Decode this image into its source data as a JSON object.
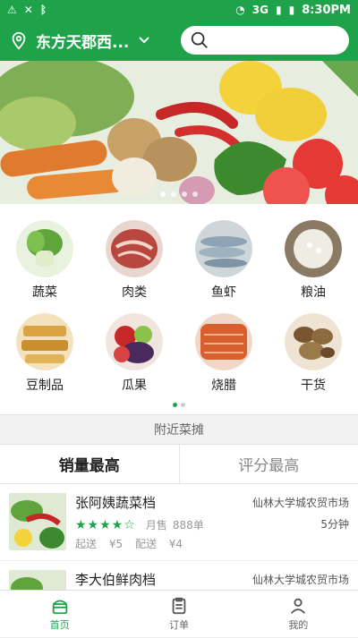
{
  "status_bar": {
    "time": "8:30PM",
    "network": "3G"
  },
  "header": {
    "location": "东方天郡西...",
    "search_placeholder": ""
  },
  "banner": {
    "slides": 4,
    "active": 0
  },
  "categories": [
    {
      "label": "蔬菜",
      "icon": "vegetables",
      "color": "#6aa84f"
    },
    {
      "label": "肉类",
      "icon": "meat",
      "color": "#c0504d"
    },
    {
      "label": "鱼虾",
      "icon": "fish",
      "color": "#8aa0b4"
    },
    {
      "label": "粮油",
      "icon": "rice",
      "color": "#d9d3c3"
    },
    {
      "label": "豆制品",
      "icon": "tofu",
      "color": "#d9a441"
    },
    {
      "label": "瓜果",
      "icon": "fruit",
      "color": "#b73a3a"
    },
    {
      "label": "烧腊",
      "icon": "roast",
      "color": "#d9602e"
    },
    {
      "label": "干货",
      "icon": "dried-goods",
      "color": "#8a6a3e"
    }
  ],
  "category_pages": 2,
  "section_title": "附近菜摊",
  "tabs": [
    {
      "label": "销量最高",
      "active": true
    },
    {
      "label": "评分最高",
      "active": false
    }
  ],
  "stalls": [
    {
      "name": "张阿姨蔬菜档",
      "market": "仙林大学城农贸市场",
      "rating": 4,
      "sold_label": "月售",
      "sold": "888单",
      "min_order_label": "起送",
      "min_order": "¥5",
      "delivery_label": "配送",
      "delivery": "¥4",
      "eta": "5分钟"
    },
    {
      "name": "李大伯鲜肉档",
      "market": "仙林大学城农贸市场"
    }
  ],
  "bottom_nav": [
    {
      "label": "首页",
      "icon": "home-icon",
      "active": true
    },
    {
      "label": "订单",
      "icon": "order-icon",
      "active": false
    },
    {
      "label": "我的",
      "icon": "profile-icon",
      "active": false
    }
  ],
  "colors": {
    "primary": "#1fa34a"
  }
}
